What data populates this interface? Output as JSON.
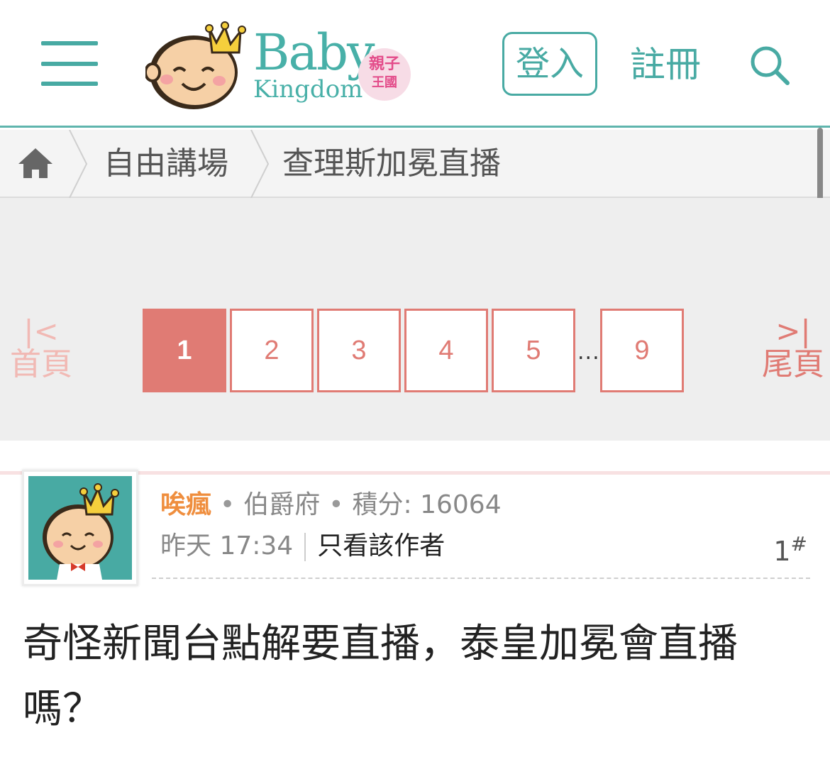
{
  "header": {
    "logo_baby": "Baby",
    "logo_kingdom": "Kingdom",
    "logo_badge_line1": "親子",
    "logo_badge_line2": "王國",
    "login_label": "登入",
    "register_label": "註冊"
  },
  "breadcrumb": {
    "items": [
      {
        "label": "自由講場"
      },
      {
        "label": "查理斯加冕直播"
      }
    ]
  },
  "pagination": {
    "first_label": "首頁",
    "last_label": "尾頁",
    "current_page": 1,
    "pages": [
      "1",
      "2",
      "3",
      "4",
      "5",
      "9"
    ],
    "ellipsis": "..."
  },
  "post": {
    "author": "唉瘋",
    "rank": "伯爵府",
    "score_label": "積分: 16064",
    "time": "昨天 17:34",
    "only_author_label": "只看該作者",
    "floor_number": "1",
    "floor_mark": "#",
    "content": "奇怪新聞台點解要直播，泰皇加冕會直播嗎？"
  },
  "colors": {
    "brand_teal": "#48aaa3",
    "pager_red": "#e07b74",
    "author_orange": "#ef8e3e"
  }
}
